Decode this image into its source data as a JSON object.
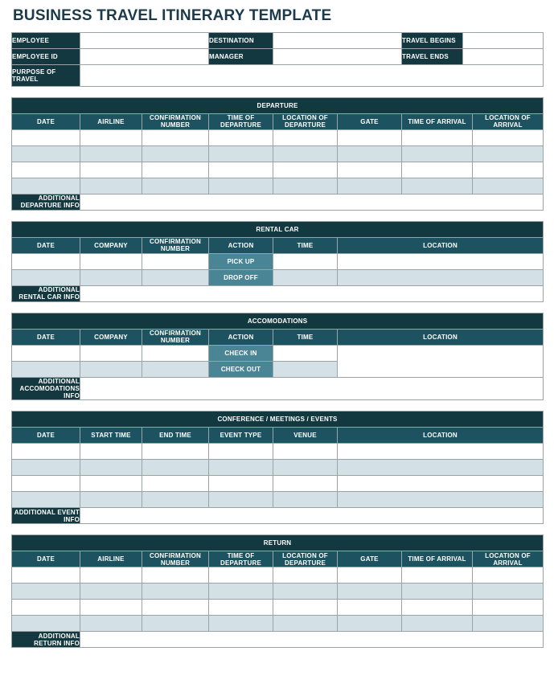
{
  "document": {
    "title": "BUSINESS TRAVEL ITINERARY TEMPLATE"
  },
  "colors": {
    "header_dark": "#143840",
    "column_header": "#1d5360",
    "action_cell": "#4a8596",
    "row_tint": "#d3e0e5",
    "title_text": "#1b3a4b",
    "border": "#9aa3a6"
  },
  "info_block": {
    "employee_label": "EMPLOYEE",
    "employee_value": "",
    "destination_label": "DESTINATION",
    "destination_value": "",
    "travel_begins_label": "TRAVEL BEGINS",
    "travel_begins_value": "",
    "employee_id_label": "EMPLOYEE ID",
    "employee_id_value": "",
    "manager_label": "MANAGER",
    "manager_value": "",
    "travel_ends_label": "TRAVEL ENDS",
    "travel_ends_value": "",
    "purpose_label": "PURPOSE OF TRAVEL",
    "purpose_value": ""
  },
  "departure": {
    "section_title": "DEPARTURE",
    "columns": [
      "DATE",
      "AIRLINE",
      "CONFIRMATION NUMBER",
      "TIME OF DEPARTURE",
      "LOCATION OF DEPARTURE",
      "GATE",
      "TIME OF ARRIVAL",
      "LOCATION OF ARRIVAL"
    ],
    "rows": [
      [
        "",
        "",
        "",
        "",
        "",
        "",
        "",
        ""
      ],
      [
        "",
        "",
        "",
        "",
        "",
        "",
        "",
        ""
      ],
      [
        "",
        "",
        "",
        "",
        "",
        "",
        "",
        ""
      ],
      [
        "",
        "",
        "",
        "",
        "",
        "",
        "",
        ""
      ]
    ],
    "additional_label": "ADDITIONAL DEPARTURE INFO",
    "additional_value": ""
  },
  "rental_car": {
    "section_title": "RENTAL CAR",
    "columns": [
      "DATE",
      "COMPANY",
      "CONFIRMATION NUMBER",
      "ACTION",
      "TIME",
      "LOCATION"
    ],
    "rows": [
      {
        "date": "",
        "company": "",
        "confirmation": "",
        "action": "PICK UP",
        "time": "",
        "location": ""
      },
      {
        "date": "",
        "company": "",
        "confirmation": "",
        "action": "DROP OFF",
        "time": "",
        "location": ""
      }
    ],
    "additional_label": "ADDITIONAL RENTAL CAR INFO",
    "additional_value": ""
  },
  "accomodations": {
    "section_title": "ACCOMODATIONS",
    "columns": [
      "DATE",
      "COMPANY",
      "CONFIRMATION NUMBER",
      "ACTION",
      "TIME",
      "LOCATION"
    ],
    "rows": [
      {
        "date": "",
        "company": "",
        "confirmation": "",
        "action": "CHECK IN",
        "time": ""
      },
      {
        "date": "",
        "company": "",
        "confirmation": "",
        "action": "CHECK OUT",
        "time": ""
      }
    ],
    "location_value": "",
    "additional_label": "ADDITIONAL ACCOMODATIONS INFO",
    "additional_value": ""
  },
  "events": {
    "section_title": "CONFERENCE / MEETINGS / EVENTS",
    "columns": [
      "DATE",
      "START TIME",
      "END TIME",
      "EVENT TYPE",
      "VENUE",
      "LOCATION"
    ],
    "rows": [
      [
        "",
        "",
        "",
        "",
        "",
        ""
      ],
      [
        "",
        "",
        "",
        "",
        "",
        ""
      ],
      [
        "",
        "",
        "",
        "",
        "",
        ""
      ],
      [
        "",
        "",
        "",
        "",
        "",
        ""
      ]
    ],
    "additional_label": "ADDITIONAL EVENT INFO",
    "additional_value": ""
  },
  "return": {
    "section_title": "RETURN",
    "columns": [
      "DATE",
      "AIRLINE",
      "CONFIRMATION NUMBER",
      "TIME OF DEPARTURE",
      "LOCATION OF DEPARTURE",
      "GATE",
      "TIME OF ARRIVAL",
      "LOCATION OF ARRIVAL"
    ],
    "rows": [
      [
        "",
        "",
        "",
        "",
        "",
        "",
        "",
        ""
      ],
      [
        "",
        "",
        "",
        "",
        "",
        "",
        "",
        ""
      ],
      [
        "",
        "",
        "",
        "",
        "",
        "",
        "",
        ""
      ],
      [
        "",
        "",
        "",
        "",
        "",
        "",
        "",
        ""
      ]
    ],
    "additional_label": "ADDITIONAL RETURN INFO",
    "additional_value": ""
  }
}
